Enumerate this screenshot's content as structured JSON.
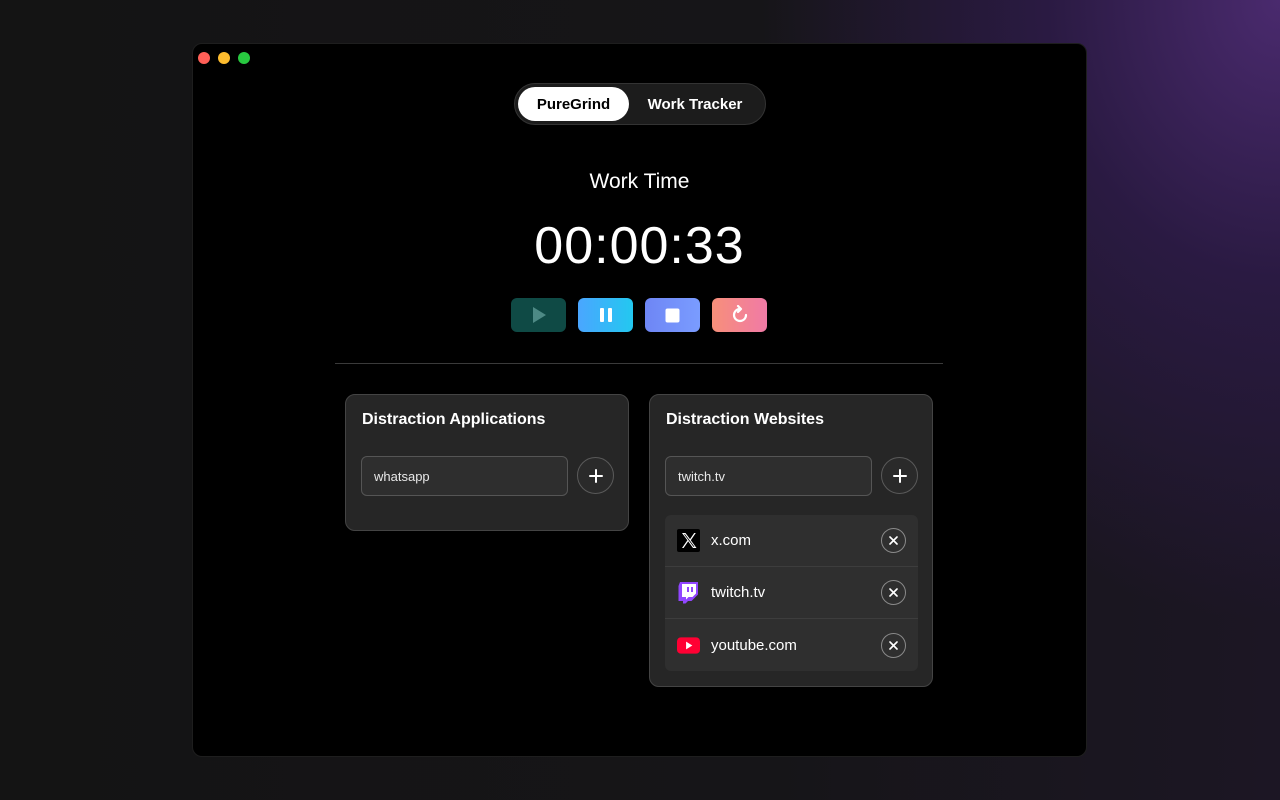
{
  "tabs": [
    {
      "label": "PureGrind",
      "active": true
    },
    {
      "label": "Work Tracker",
      "active": false
    }
  ],
  "timer": {
    "label": "Work Time",
    "value": "00:00:33"
  },
  "controls": [
    {
      "name": "play",
      "icon": "play-icon"
    },
    {
      "name": "pause",
      "icon": "pause-icon"
    },
    {
      "name": "stop",
      "icon": "stop-icon"
    },
    {
      "name": "reset",
      "icon": "refresh-icon"
    }
  ],
  "apps_card": {
    "title": "Distraction Applications",
    "input_value": "whatsapp"
  },
  "sites_card": {
    "title": "Distraction Websites",
    "input_value": "twitch.tv",
    "items": [
      {
        "label": "x.com",
        "icon": "x-logo-icon"
      },
      {
        "label": "twitch.tv",
        "icon": "twitch-logo-icon"
      },
      {
        "label": "youtube.com",
        "icon": "youtube-logo-icon"
      }
    ]
  },
  "colors": {
    "play": "#0f4a45",
    "twitch": "#9146ff",
    "youtube": "#ff0033"
  }
}
